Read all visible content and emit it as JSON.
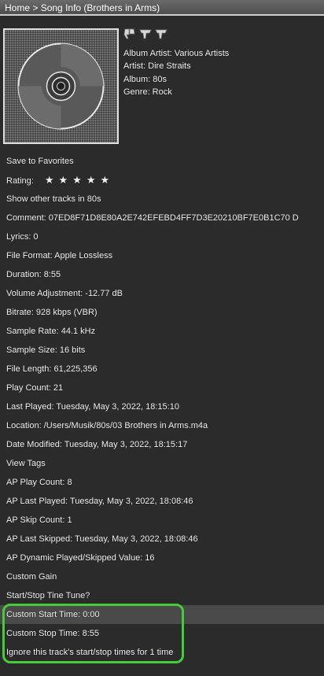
{
  "breadcrumb": {
    "home": "Home",
    "separator": " > ",
    "current": "Song Info (Brothers in Arms)"
  },
  "header_icons": [
    "thumbs-down-icon",
    "thumbs-up-icon",
    "thumbs-up-icon"
  ],
  "meta": {
    "album_artist": "Album Artist: Various Artists",
    "artist": "Artist: Dire Straits",
    "album": "Album: 80s",
    "genre": "Genre: Rock"
  },
  "rows": [
    {
      "name": "save-to-favorites",
      "text": "Save to Favorites",
      "interactable": true
    },
    {
      "name": "rating",
      "text": "Rating:",
      "stars": "★★★★★",
      "interactable": true
    },
    {
      "name": "show-other-tracks",
      "text": "Show other tracks in 80s",
      "interactable": true
    },
    {
      "name": "comment",
      "text": "Comment: 07ED8F71D8E80A2E742EFEBD4FF7D3E20210BF7E0B1C70 D",
      "interactable": false
    },
    {
      "name": "lyrics",
      "text": "Lyrics: 0",
      "interactable": false
    },
    {
      "name": "file-format",
      "text": "File Format: Apple Lossless",
      "interactable": false
    },
    {
      "name": "duration",
      "text": "Duration: 8:55",
      "interactable": false
    },
    {
      "name": "volume-adjustment",
      "text": "Volume Adjustment: -12.77 dB",
      "interactable": false
    },
    {
      "name": "bitrate",
      "text": "Bitrate: 928 kbps (VBR)",
      "interactable": false
    },
    {
      "name": "sample-rate",
      "text": "Sample Rate: 44.1 kHz",
      "interactable": false
    },
    {
      "name": "sample-size",
      "text": "Sample Size: 16 bits",
      "interactable": false
    },
    {
      "name": "file-length",
      "text": "File Length: 61,225,356",
      "interactable": false
    },
    {
      "name": "play-count",
      "text": "Play Count: 21",
      "interactable": false
    },
    {
      "name": "last-played",
      "text": "Last Played: Tuesday, May 3, 2022, 18:15:10",
      "interactable": false
    },
    {
      "name": "location",
      "text": "Location: /Users/Musik/80s/03 Brothers in Arms.m4a",
      "interactable": true
    },
    {
      "name": "date-modified",
      "text": "Date Modified: Tuesday, May 3, 2022, 18:15:17",
      "interactable": false
    },
    {
      "name": "view-tags",
      "text": "View Tags",
      "interactable": true
    },
    {
      "name": "ap-play-count",
      "text": "AP Play Count: 8",
      "interactable": false
    },
    {
      "name": "ap-last-played",
      "text": "AP Last Played: Tuesday, May 3, 2022, 18:08:46",
      "interactable": false
    },
    {
      "name": "ap-skip-count",
      "text": "AP Skip Count: 1",
      "interactable": false
    },
    {
      "name": "ap-last-skipped",
      "text": "AP Last Skipped: Tuesday, May 3, 2022, 18:08:46",
      "interactable": false
    },
    {
      "name": "ap-dynamic-played-skipped",
      "text": "AP Dynamic Played/Skipped Value: 16",
      "interactable": false
    },
    {
      "name": "custom-gain",
      "text": "Custom Gain",
      "interactable": true
    },
    {
      "name": "start-stop-times",
      "text": "Start/Stop Tine Tune?",
      "interactable": true
    },
    {
      "name": "custom-start-time",
      "text": "Custom Start Time: 0:00",
      "interactable": true,
      "highlight": true
    },
    {
      "name": "custom-stop-time",
      "text": "Custom Stop Time: 8:55",
      "interactable": true
    },
    {
      "name": "ignore-tracks-start-stop",
      "text": "Ignore this track's start/stop times for 1 time",
      "interactable": true
    }
  ],
  "colors": {
    "background": "#2b2b2b",
    "topbar": "#5a5a5a",
    "row_highlight": "#4a4a4a",
    "annotation": "#44cc3a"
  }
}
